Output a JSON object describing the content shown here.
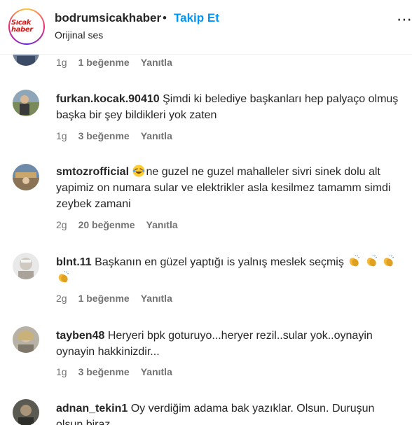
{
  "header": {
    "username": "bodrumsicakhaber",
    "separator": "•",
    "follow_label": "Takip Et",
    "audio_label": "Orijinal ses",
    "logo_text": "Sıcak haber"
  },
  "comments": [
    {
      "username": "",
      "text": "",
      "time": "1g",
      "likes": "1 beğenme",
      "reply": "Yanıtla"
    },
    {
      "username": "furkan.kocak.90410",
      "text": "Şimdi ki belediye başkanları hep palyaço olmuş başka bir şey bildikleri yok zaten",
      "time": "1g",
      "likes": "3 beğenme",
      "reply": "Yanıtla"
    },
    {
      "username": "smtozrofficial",
      "text": "ne guzel ne guzel mahalleler sivri sinek dolu alt yapimiz on numara sular ve elektrikler asla kesilmez tamamm simdi zeybek zamani",
      "time": "2g",
      "likes": "20 beğenme",
      "reply": "Yanıtla",
      "emoji": "laughing-face"
    },
    {
      "username": "blnt.11",
      "text": "Başkanın en güzel yaptığı is yalnış meslek seçmiş",
      "time": "2g",
      "likes": "1 beğenme",
      "reply": "Yanıtla",
      "emoji": "clapping-hands"
    },
    {
      "username": "tayben48",
      "text": "Heryeri bpk goturuyo...heryer rezil..sular yok..oynayin oynayin hakkinizdir...",
      "time": "1g",
      "likes": "3 beğenme",
      "reply": "Yanıtla"
    },
    {
      "username": "adnan_tekin1",
      "text": "Oy verdiğim adama bak yazıklar. Olsun. Duruşun olsun biraz",
      "time": "",
      "likes": "",
      "reply": ""
    }
  ],
  "colors": {
    "accent": "#0095f6",
    "text": "#262626",
    "muted": "#737373",
    "logo_red": "#d11a1a"
  }
}
